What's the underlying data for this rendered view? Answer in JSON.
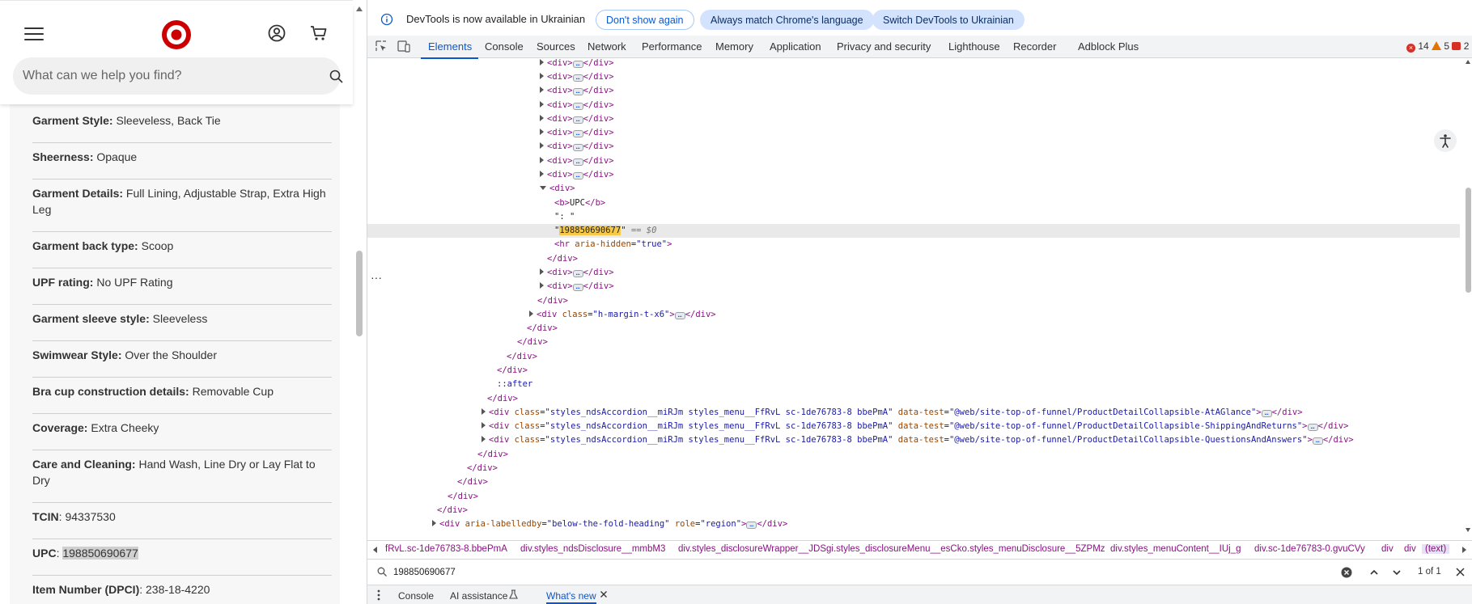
{
  "page": {
    "search": {
      "placeholder": "What can we help you find?"
    },
    "specs": [
      {
        "label": "Garment Style:",
        "value": " Sleeveless, Back Tie"
      },
      {
        "label": "Sheerness:",
        "value": " Opaque"
      },
      {
        "label": "Garment Details:",
        "value": " Full Lining, Adjustable Strap, Extra High Leg"
      },
      {
        "label": "Garment back type:",
        "value": " Scoop"
      },
      {
        "label": "UPF rating:",
        "value": " No UPF Rating"
      },
      {
        "label": "Garment sleeve style:",
        "value": " Sleeveless"
      },
      {
        "label": "Swimwear Style:",
        "value": " Over the Shoulder"
      },
      {
        "label": "Bra cup construction details:",
        "value": " Removable Cup"
      },
      {
        "label": "Coverage:",
        "value": " Extra Cheeky"
      },
      {
        "label": "Care and Cleaning:",
        "value": " Hand Wash, Line Dry or Lay Flat to Dry"
      },
      {
        "label": "TCIN",
        "value": ": 94337530"
      },
      {
        "label": "UPC",
        "value": ": ",
        "highlight": "198850690677"
      },
      {
        "label": "Item Number (DPCI)",
        "value": ": 238-18-4220"
      }
    ],
    "colors": {
      "brand": "#cc0000"
    }
  },
  "devtools": {
    "infobar": {
      "message": "DevTools is now available in Ukrainian",
      "dont_show": "Don't show again",
      "always_match": "Always match Chrome's language",
      "switch": "Switch DevTools to Ukrainian"
    },
    "tabs": [
      "Elements",
      "Console",
      "Sources",
      "Network",
      "Performance",
      "Memory",
      "Application",
      "Privacy and security",
      "Lighthouse",
      "Recorder",
      "Adblock Plus"
    ],
    "counts": {
      "errors": "14",
      "warnings": "5",
      "issues": "2"
    },
    "tree": {
      "div_open": "<div>",
      "div_close": "</div>",
      "b_open": "<b>",
      "b_close": "</b>",
      "upc_label": "UPC",
      "colon_text": "\": \"",
      "selected_value": "198850690677",
      "eq_dollar": "== $0",
      "hr_tag": "<hr",
      "hr_attr": "aria-hidden",
      "hr_val": "\"true\"",
      "margin_class": "\"h-margin-t-x6\"",
      "after": "::after",
      "accordion_class": "\"styles_ndsAccordion__miRJm styles_menu__FfRvL sc-1de76783-8 bbePmA\"",
      "datatest_1": "\"@web/site-top-of-funnel/ProductDetailCollapsible-AtAGlance\"",
      "datatest_2": "\"@web/site-top-of-funnel/ProductDetailCollapsible-ShippingAndReturns\"",
      "datatest_3": "\"@web/site-top-of-funnel/ProductDetailCollapsible-QuestionsAndAnswers\"",
      "region_labelledby": "\"below-the-fold-heading\"",
      "region_role": "\"region\""
    },
    "breadcrumbs": [
      "fRvL.sc-1de76783-8.bbePmA",
      "div.styles_ndsDisclosure__mmbM3",
      "div.styles_disclosureWrapper__JDSgi.styles_disclosureMenu__esCko.styles_menuDisclosure__5ZPMz",
      "div.styles_menuContent__IUj_g",
      "div.sc-1de76783-0.gvuCVy",
      "div",
      "div",
      "(text)"
    ],
    "find": {
      "value": "198850690677",
      "count": "1 of 1"
    },
    "drawer": {
      "console": "Console",
      "ai": "AI assistance",
      "whats_new": "What's new"
    }
  }
}
